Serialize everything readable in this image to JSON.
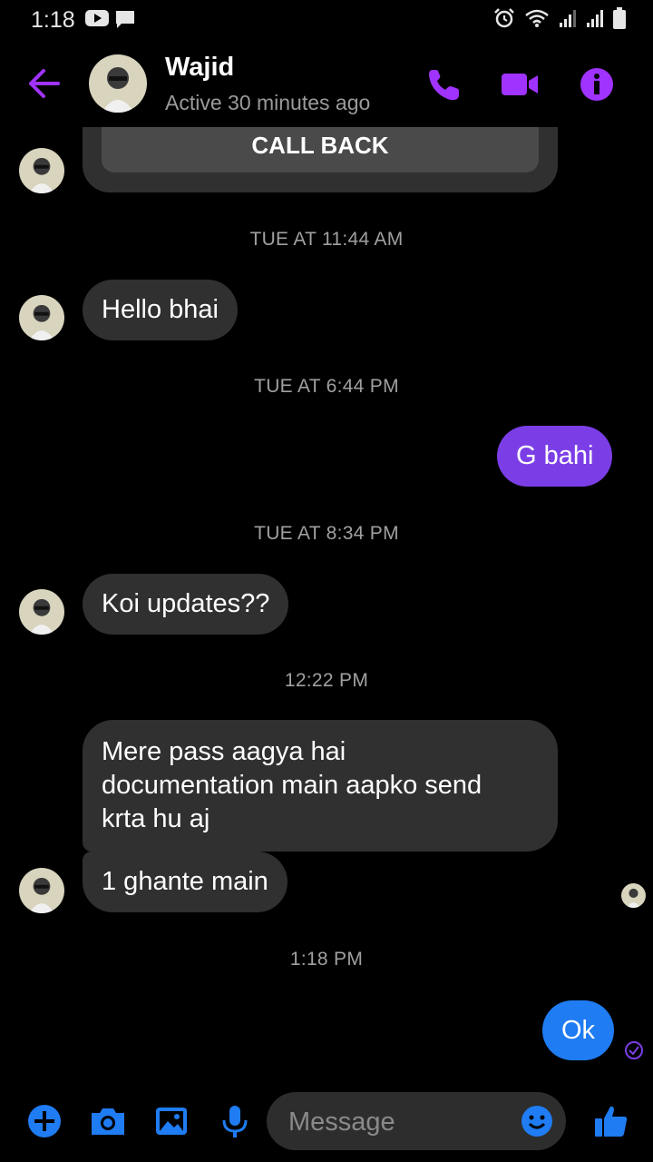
{
  "status_bar": {
    "time": "1:18"
  },
  "header": {
    "name": "Wajid",
    "active_status": "Active 30 minutes ago",
    "accent_color": "#a033ff"
  },
  "call_card": {
    "button_label": "CALL BACK"
  },
  "messages": [
    {
      "timestamp": "TUE AT 11:44 AM"
    },
    {
      "from": "contact",
      "text": "Hello bhai"
    },
    {
      "timestamp": "TUE AT 6:44 PM"
    },
    {
      "from": "me",
      "text": "G bahi"
    },
    {
      "timestamp": "TUE AT 8:34 PM"
    },
    {
      "from": "contact",
      "text": "Koi updates??"
    },
    {
      "timestamp": "12:22 PM"
    },
    {
      "from": "contact",
      "lines": [
        "Mere pass aagya hai",
        "documentation main aapko send",
        "krta hu aj"
      ]
    },
    {
      "from": "contact",
      "text": "1 ghante main"
    },
    {
      "timestamp": "1:18 PM"
    },
    {
      "from": "me",
      "text": "Ok"
    }
  ],
  "composer": {
    "placeholder": "Message"
  },
  "colors": {
    "outgoing_bubble": "#7b3ee6",
    "incoming_bubble": "#303030",
    "latest_outgoing_bubble": "#1f7cf2",
    "composer_icons": "#1f7cf2"
  },
  "icons": [
    "back-arrow-icon",
    "phone-icon",
    "video-camera-icon",
    "info-icon",
    "plus-icon",
    "camera-icon",
    "gallery-icon",
    "microphone-icon",
    "emoji-icon",
    "thumbs-up-icon",
    "sent-check-icon"
  ]
}
